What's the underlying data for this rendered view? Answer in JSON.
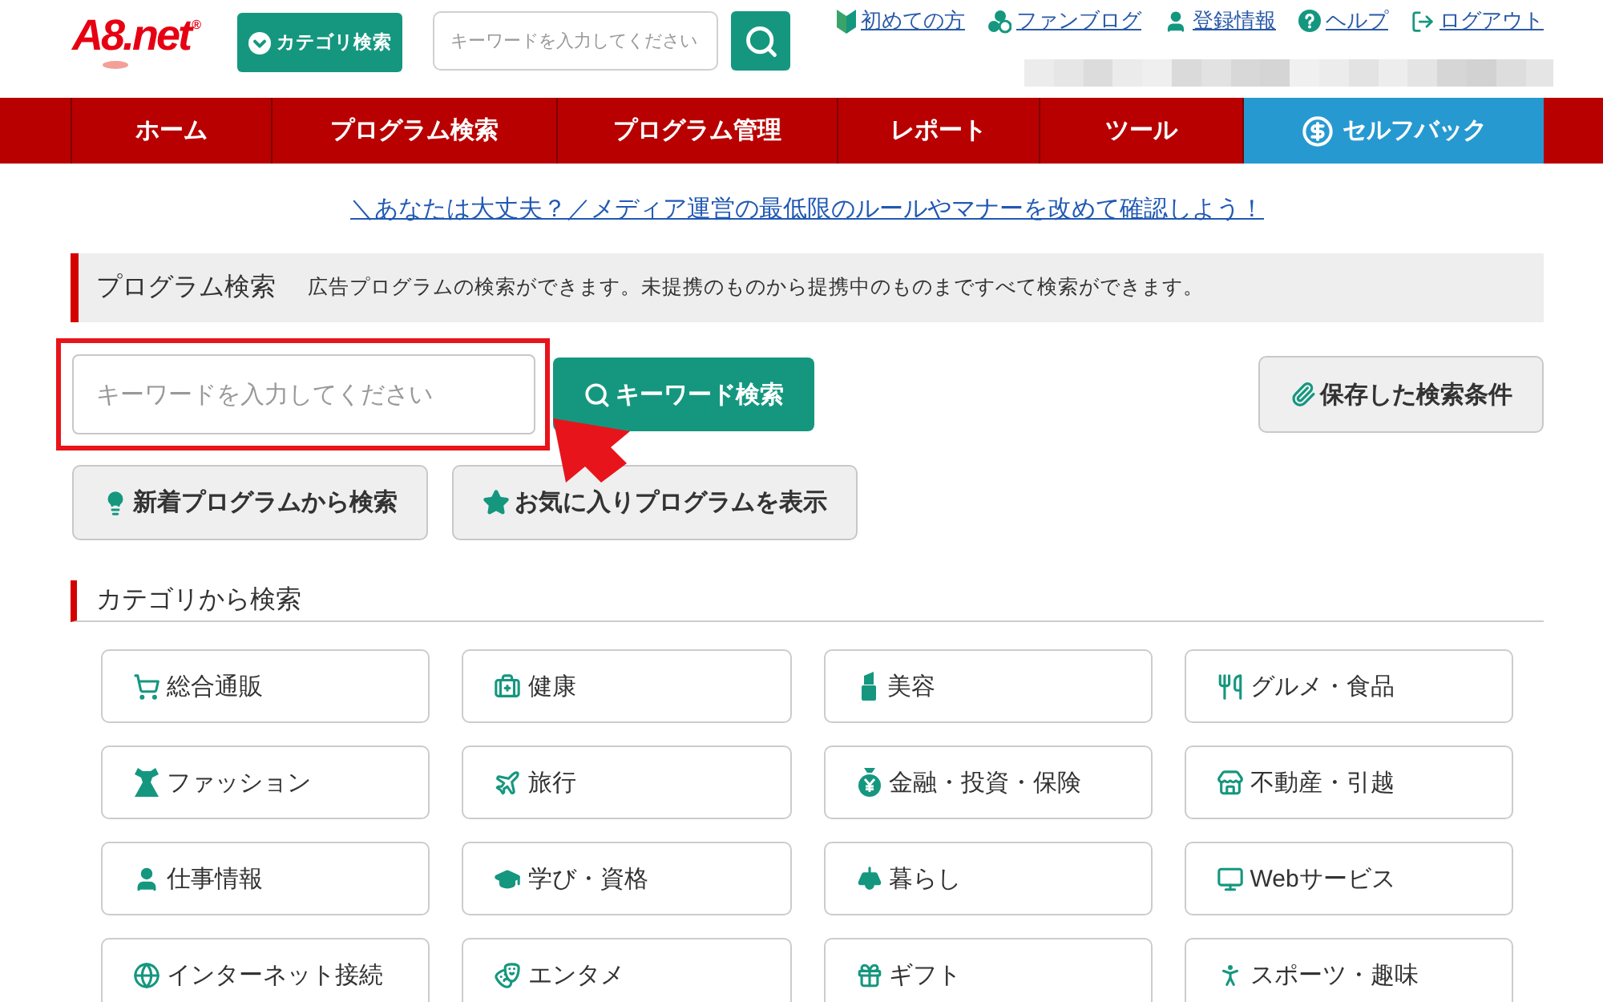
{
  "header": {
    "logo": "A8.net$^{®}$",
    "category_button": "カテゴリ検索",
    "search": {
      "placeholder": "キーワードを入力してください"
    },
    "links": [
      "初めての方",
      "ファンブログ",
      "登録情報",
      "ヘルプ",
      "ログアウト"
    ]
  },
  "nav": [
    {
      "label": "ホーム",
      "kind": "plain"
    },
    {
      "label": "プログラム検索",
      "kind": "plain"
    },
    {
      "label": "プログラム管理",
      "kind": "plain"
    },
    {
      "label": "レポート",
      "kind": "plain"
    },
    {
      "label": "ツール",
      "kind": "plain"
    },
    {
      "label": "セルフバック",
      "kind": "featured"
    }
  ],
  "notice_link": "＼あなたは大丈夫？／メディア運営の最低限のルールやマナーを改めて確認しよう！",
  "program_search": {
    "title": "プログラム検索",
    "description": "広告プログラムの検索ができます。未提携のものから提携中のものまですべて検索ができます。",
    "keyword": {
      "placeholder": "キーワードを入力してください"
    },
    "search_button": "キーワード検索",
    "saved_button": "保存した検索条件",
    "buttons": [
      "新着プログラムから検索",
      "お気に入りプログラムを表示"
    ]
  },
  "categories": {
    "title": "カテゴリから検索",
    "items": [
      "総合通販",
      "健康",
      "美容",
      "グルメ・食品",
      "ファッション",
      "旅行",
      "金融・投資・保険",
      "不動産・引越",
      "仕事情報",
      "学び・資格",
      "暮らし",
      "Webサービス",
      "インターネット接続",
      "エンタメ",
      "ギフト",
      "スポーツ・趣味"
    ]
  }
}
